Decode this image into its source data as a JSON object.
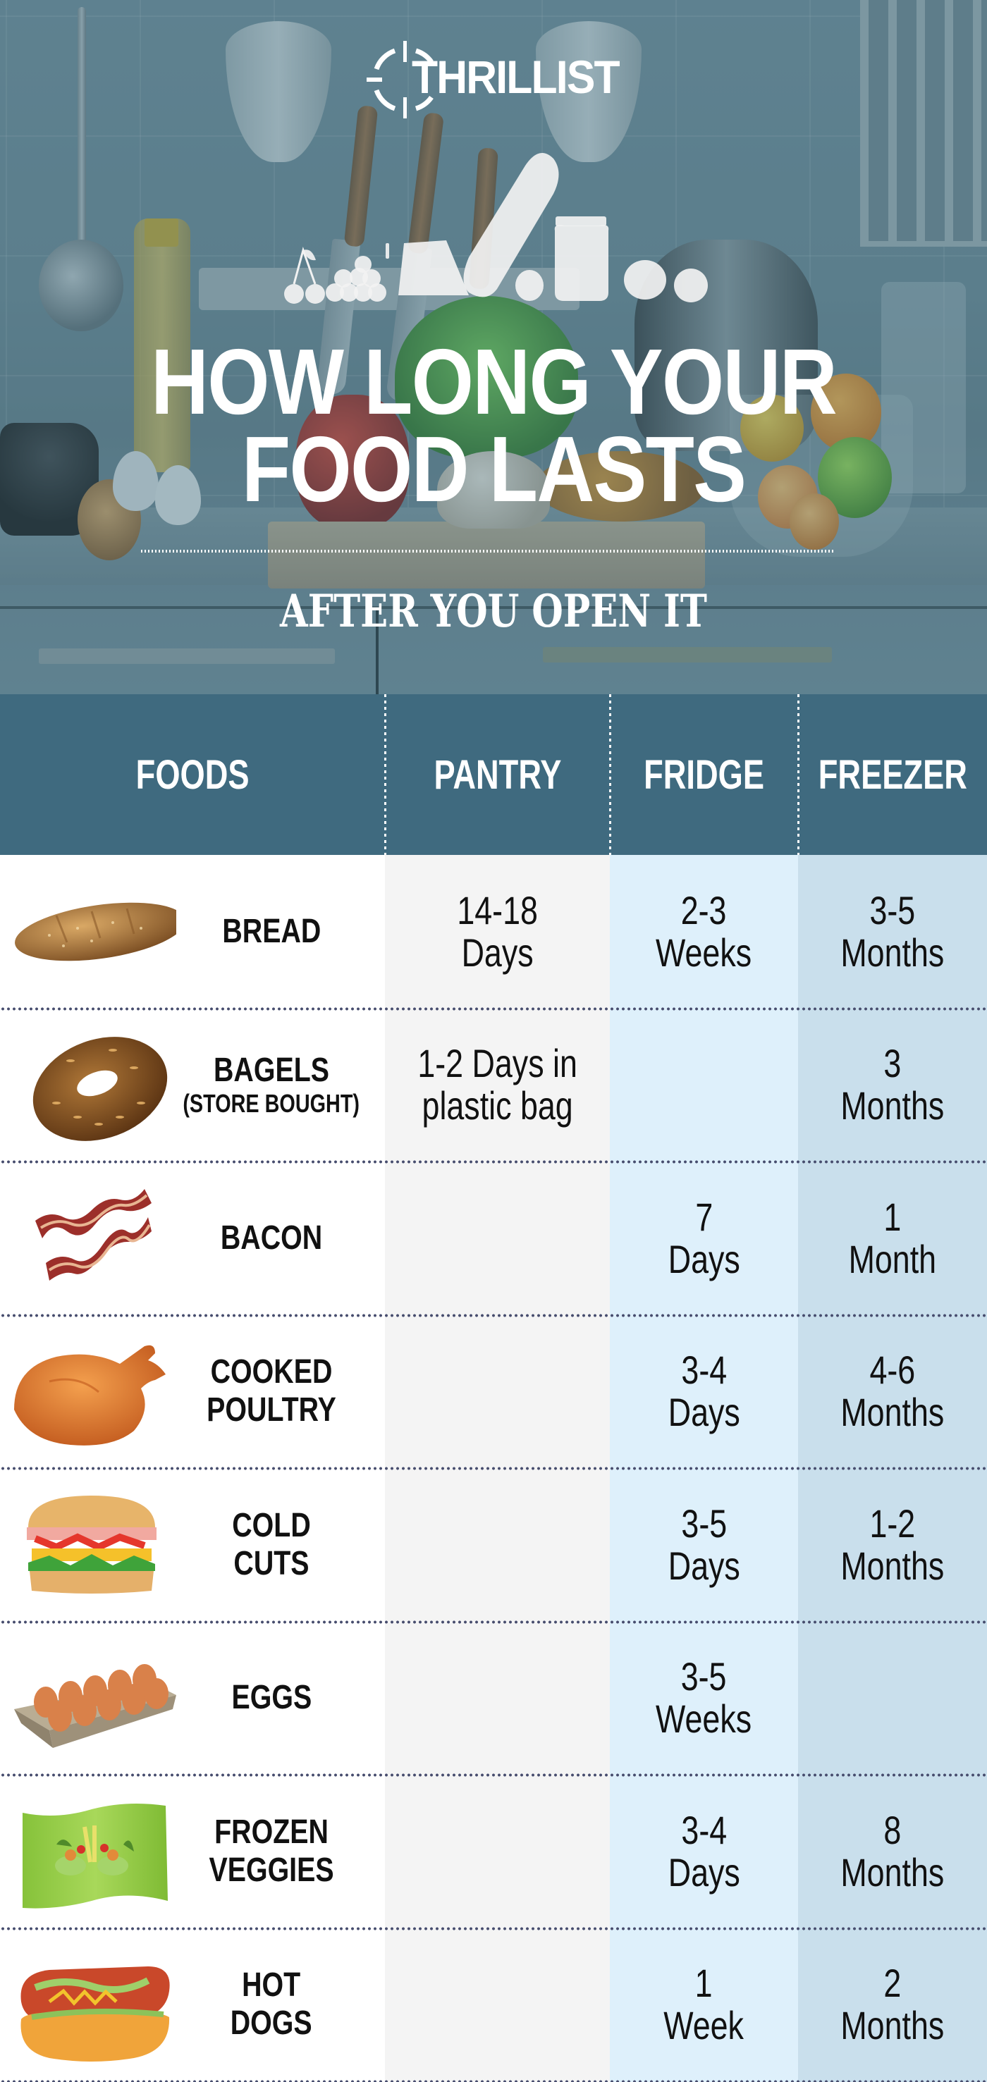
{
  "brand": {
    "logo_text": "THRILLIST",
    "logo_icon": "crosshair-icon"
  },
  "hero": {
    "title_line1": "HOW LONG YOUR",
    "title_line2": "FOOD LASTS",
    "subtitle": "AFTER YOU OPEN IT",
    "icons": [
      "cherries-icon",
      "grapes-icon",
      "cheese-icon",
      "baguette-icon",
      "lemon-icon",
      "jar-icon",
      "onion-icon",
      "tomato-icon"
    ]
  },
  "table": {
    "headers": {
      "foods": "FOODS",
      "pantry": "PANTRY",
      "fridge": "FRIDGE",
      "freezer": "FREEZER"
    },
    "colors": {
      "header_bg": "#3f6a7f",
      "foods_bg": "#ffffff",
      "pantry_bg": "#f4f4f4",
      "fridge_bg": "#def0fb",
      "freezer_bg": "#c9dfec",
      "divider": "#474d6e"
    },
    "rows": [
      {
        "name": "BREAD",
        "sub": "",
        "icon": "bread-icon",
        "pantry": "14-18\nDays",
        "fridge": "2-3\nWeeks",
        "freezer": "3-5\nMonths"
      },
      {
        "name": "BAGELS",
        "sub": "(STORE BOUGHT)",
        "icon": "bagel-icon",
        "pantry": "1-2 Days in\nplastic bag",
        "fridge": "",
        "freezer": "3\nMonths"
      },
      {
        "name": "BACON",
        "sub": "",
        "icon": "bacon-icon",
        "pantry": "",
        "fridge": "7\nDays",
        "freezer": "1\nMonth"
      },
      {
        "name": "COOKED\nPOULTRY",
        "sub": "",
        "icon": "roast-chicken-icon",
        "pantry": "",
        "fridge": "3-4\nDays",
        "freezer": "4-6\nMonths"
      },
      {
        "name": "COLD\nCUTS",
        "sub": "",
        "icon": "sandwich-icon",
        "pantry": "",
        "fridge": "3-5\nDays",
        "freezer": "1-2\nMonths"
      },
      {
        "name": "EGGS",
        "sub": "",
        "icon": "egg-carton-icon",
        "pantry": "",
        "fridge": "3-5\nWeeks",
        "freezer": ""
      },
      {
        "name": "FROZEN\nVEGGIES",
        "sub": "",
        "icon": "frozen-veggie-bag-icon",
        "pantry": "",
        "fridge": "3-4\nDays",
        "freezer": "8\nMonths"
      },
      {
        "name": "HOT\nDOGS",
        "sub": "",
        "icon": "hot-dog-icon",
        "pantry": "",
        "fridge": "1\nWeek",
        "freezer": "2\nMonths"
      }
    ]
  }
}
